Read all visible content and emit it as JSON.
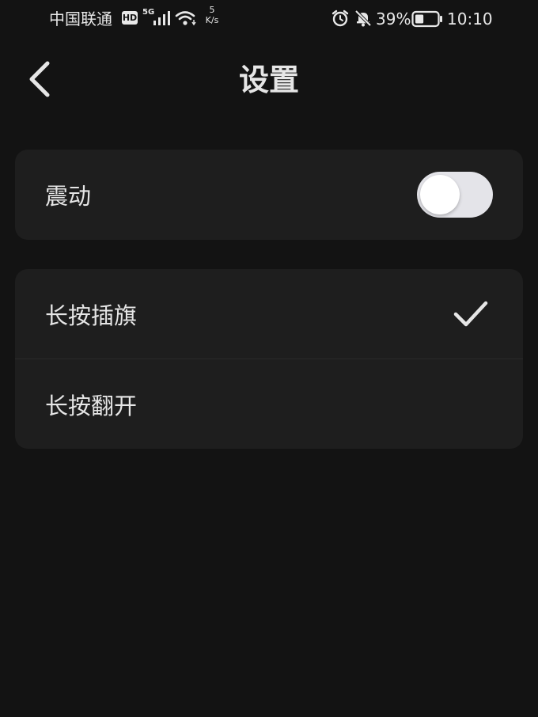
{
  "status_bar": {
    "carrier": "中国联通",
    "hd_badge": "HD",
    "network_type": "5G",
    "speed_value": "5",
    "speed_unit": "K/s",
    "battery_percent": "39%",
    "battery_level": 0.39,
    "time": "10:10",
    "icons": [
      "signal-icon",
      "wifi-icon",
      "alarm-icon",
      "mute-icon",
      "battery-icon"
    ]
  },
  "header": {
    "title": "设置",
    "back_icon": "chevron-left-icon"
  },
  "settings": {
    "vibrate": {
      "label": "震动",
      "enabled": false
    },
    "long_press_options": [
      {
        "label": "长按插旗",
        "selected": true
      },
      {
        "label": "长按翻开",
        "selected": false
      }
    ]
  },
  "colors": {
    "background": "#131313",
    "card": "#1e1e1e",
    "text": "#e6e6e6",
    "toggle_track": "#e4e4e9",
    "toggle_knob": "#ffffff"
  }
}
